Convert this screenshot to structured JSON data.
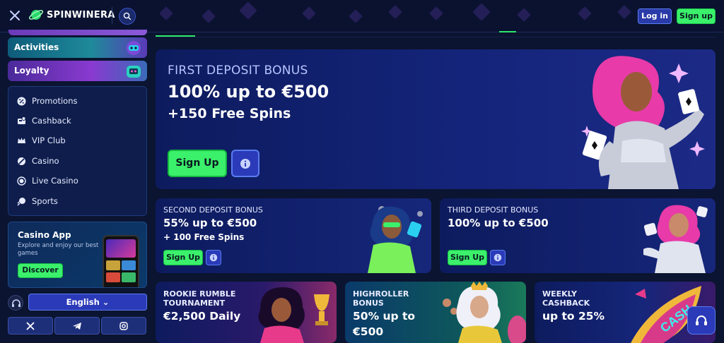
{
  "header": {
    "brand": "SPINWINERA",
    "login_label": "Log in",
    "signup_label": "Sign up"
  },
  "sidebar": {
    "activities_label": "Activities",
    "loyalty_label": "Loyalty",
    "menu": [
      {
        "label": "Promotions",
        "icon": "percent-icon"
      },
      {
        "label": "Cashback",
        "icon": "cashback-icon"
      },
      {
        "label": "VIP Club",
        "icon": "crown-icon"
      },
      {
        "label": "Casino",
        "icon": "chip-icon"
      },
      {
        "label": "Live Casino",
        "icon": "live-icon"
      },
      {
        "label": "Sports",
        "icon": "ball-icon"
      }
    ],
    "app": {
      "title": "Casino App",
      "subtitle": "Explore and enjoy our best games",
      "button": "Discover"
    },
    "language": "English",
    "socials": [
      "x-icon",
      "telegram-icon",
      "instagram-icon"
    ]
  },
  "hero": {
    "kicker": "FIRST DEPOSIT BONUS",
    "title": "100% up to €500",
    "subtitle": "+150 Free Spins",
    "signup": "Sign Up"
  },
  "cards": {
    "second": {
      "kicker": "SECOND DEPOSIT BONUS",
      "title": "55% up to €500",
      "extra": "+ 100 Free Spins",
      "signup": "Sign Up"
    },
    "third": {
      "kicker": "THIRD DEPOSIT BONUS",
      "title": "100% up to €500",
      "signup": "Sign Up"
    },
    "rookie": {
      "kicker_1": "ROOKIE RUMBLE",
      "kicker_2": "TOURNAMENT",
      "title": "€2,500 Daily"
    },
    "highroller": {
      "kicker_1": "HIGHROLLER",
      "kicker_2": "BONUS",
      "title_1": "50% up to",
      "title_2": "€500"
    },
    "weekly": {
      "kicker_1": "WEEKLY",
      "kicker_2": "CASHBACK",
      "title": "up to 25%"
    }
  },
  "colors": {
    "accent_green": "#3bf06b",
    "accent_blue": "#2a3ab8",
    "bg": "#0b1430"
  }
}
